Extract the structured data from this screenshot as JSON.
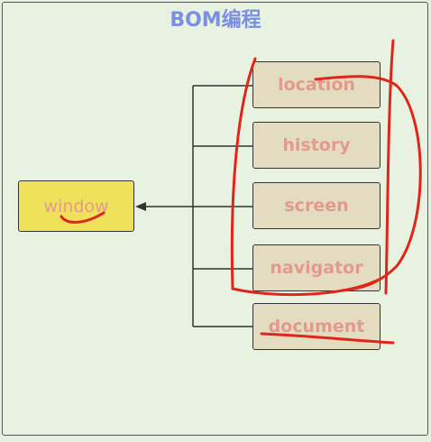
{
  "title": "BOM编程",
  "window": {
    "label": "window"
  },
  "objects": [
    {
      "label": "location"
    },
    {
      "label": "history"
    },
    {
      "label": "screen"
    },
    {
      "label": "navigator"
    },
    {
      "label": "document"
    }
  ],
  "colors": {
    "annotation": "#e0251b",
    "box_fill": "#e4dcc0",
    "window_fill": "#f0e15a",
    "title": "#7b8fe0"
  }
}
